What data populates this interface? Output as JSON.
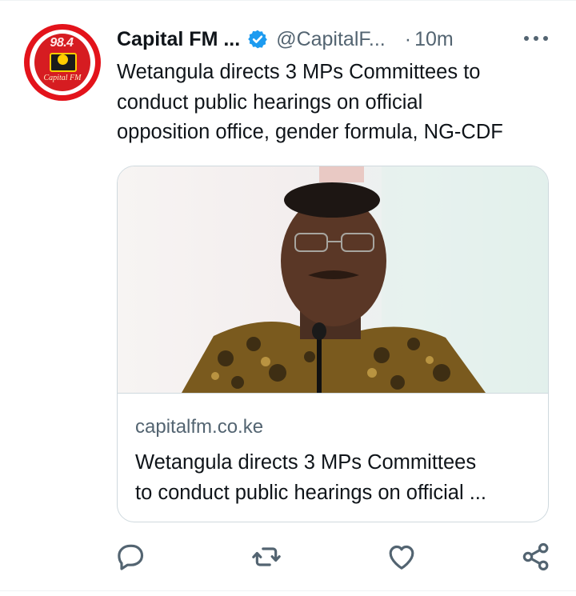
{
  "tweet": {
    "avatar": {
      "frequency": "98.4",
      "brand": "Capital FM"
    },
    "author_name": "Capital FM ...",
    "verified": true,
    "handle": "@CapitalF...",
    "separator": "·",
    "time": "10m",
    "text_lines": [
      "Wetangula directs 3 MPs Committees to",
      "conduct public hearings on official",
      "opposition office, gender formula, NG-CDF"
    ],
    "card": {
      "domain": "capitalfm.co.ke",
      "title_lines": [
        "Wetangula directs 3 MPs Committees",
        "to conduct public hearings on official ..."
      ]
    },
    "actions": [
      {
        "icon": "reply-icon"
      },
      {
        "icon": "retweet-icon"
      },
      {
        "icon": "like-icon"
      },
      {
        "icon": "share-icon"
      }
    ]
  },
  "colors": {
    "text": "#0f1419",
    "secondary": "#536471",
    "verified": "#1d9bf0",
    "border": "#cfd9de",
    "avatar_red": "#e3131b"
  }
}
